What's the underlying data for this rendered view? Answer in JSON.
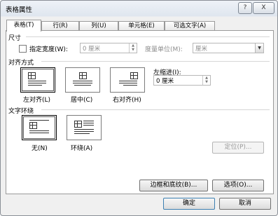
{
  "window": {
    "title": "表格属性",
    "help_glyph": "?",
    "close_glyph": "X"
  },
  "tabs": [
    {
      "label": "表格(T)"
    },
    {
      "label": "行(R)"
    },
    {
      "label": "列(U)"
    },
    {
      "label": "单元格(E)"
    },
    {
      "label": "可选文字(A)"
    }
  ],
  "size": {
    "heading": "尺寸",
    "width_checkbox_label": "指定宽度(W):",
    "width_value": "0 厘米",
    "unit_label": "度量单位(M):",
    "unit_value": "厘米"
  },
  "alignment": {
    "heading": "对齐方式",
    "options": [
      {
        "label": "左对齐(L)"
      },
      {
        "label": "居中(C)"
      },
      {
        "label": "右对齐(H)"
      }
    ],
    "indent_label": "左缩进(I):",
    "indent_value": "0 厘米"
  },
  "wrapping": {
    "heading": "文字环绕",
    "options": [
      {
        "label": "无(N)"
      },
      {
        "label": "环绕(A)"
      }
    ],
    "position_button": "定位(P)..."
  },
  "bottom": {
    "borders_button": "边框和底纹(B)...",
    "options_button": "选项(O)...",
    "ok_button": "确定",
    "cancel_button": "取消"
  }
}
